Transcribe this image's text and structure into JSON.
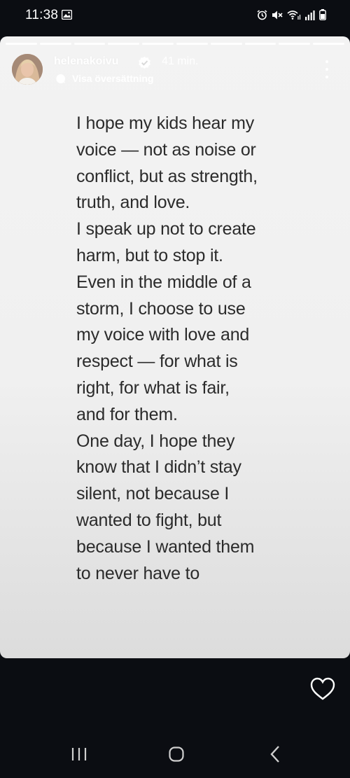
{
  "status_bar": {
    "time": "11:38",
    "left_icons": [
      "gallery-icon"
    ],
    "right_icons": [
      "alarm-icon",
      "mute-icon",
      "wifi-icon",
      "signal-icon",
      "battery-icon"
    ]
  },
  "story": {
    "progress_segments": 10,
    "username": "helenakoivu",
    "verified": true,
    "time_ago": "41 min.",
    "translate_label": "Visa översättning",
    "text": "I hope my kids hear my\nvoice — not as noise or\nconflict, but as strength,\ntruth, and love.\nI speak up not to create\nharm, but to stop it.\nEven in the middle of a\nstorm, I choose to use\nmy voice with love and\nrespect — for what is\nright, for what is fair,\nand for them.\nOne day, I hope they\nknow that I didn’t stay\nsilent, not because I\nwanted to fight, but\nbecause I wanted them\nto never have to",
    "background_color": "#f2f2f2",
    "text_color": "#2b2b2b"
  },
  "actions": {
    "like_icon": "heart-icon"
  },
  "navigation": {
    "buttons": [
      "recents-icon",
      "home-icon",
      "back-icon"
    ]
  },
  "colors": {
    "page_background": "#0b0d12",
    "accent": "#ffffff"
  }
}
